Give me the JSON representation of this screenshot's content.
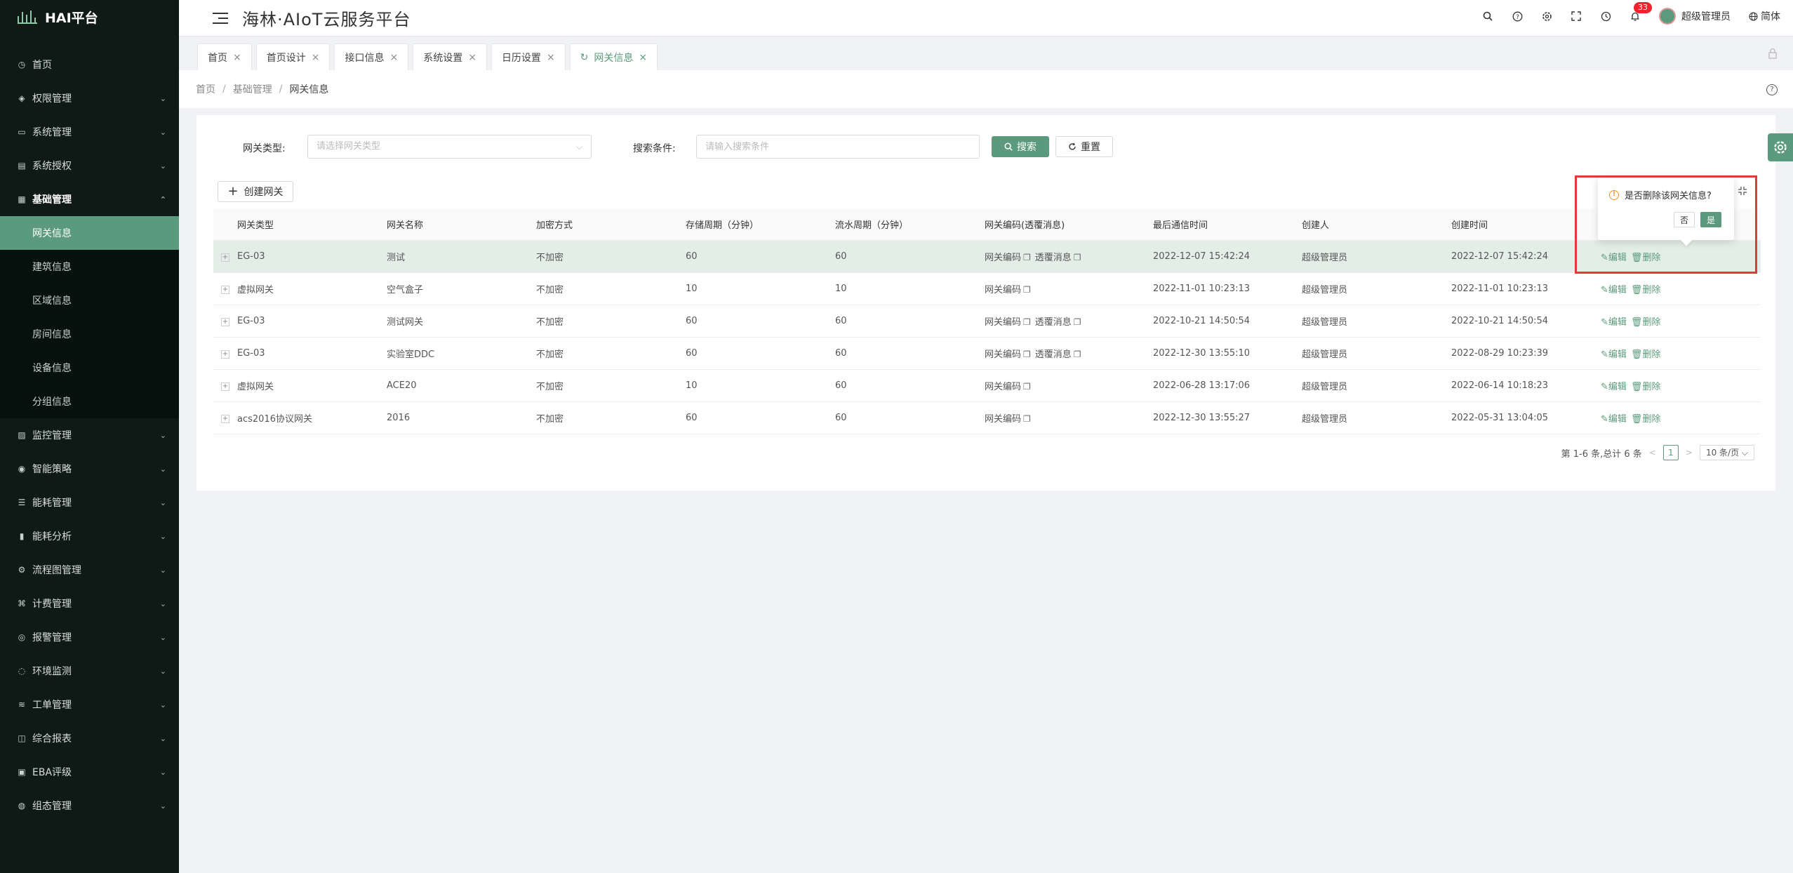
{
  "brand": {
    "name": "HAI平台"
  },
  "header": {
    "title": "海林·AIoT云服务平台",
    "notification_count": "33",
    "user_name": "超级管理员",
    "lang": "简体",
    "icons": [
      "search-icon",
      "question-icon",
      "settings-icon",
      "fullscreen-icon",
      "clock-icon",
      "bell-icon"
    ]
  },
  "sidebar": {
    "items": [
      {
        "label": "首页",
        "icon": "dashboard-icon"
      },
      {
        "label": "权限管理",
        "icon": "shield-icon"
      },
      {
        "label": "系统管理",
        "icon": "monitor-icon"
      },
      {
        "label": "系统授权",
        "icon": "license-icon"
      },
      {
        "label": "基础管理",
        "icon": "grid-icon"
      }
    ],
    "sub_items": [
      {
        "label": "网关信息"
      },
      {
        "label": "建筑信息"
      },
      {
        "label": "区域信息"
      },
      {
        "label": "房间信息"
      },
      {
        "label": "设备信息"
      },
      {
        "label": "分组信息"
      }
    ],
    "items_after": [
      {
        "label": "监控管理"
      },
      {
        "label": "智能策略"
      },
      {
        "label": "能耗管理"
      },
      {
        "label": "能耗分析"
      },
      {
        "label": "流程图管理"
      },
      {
        "label": "计费管理"
      },
      {
        "label": "报警管理"
      },
      {
        "label": "环境监测"
      },
      {
        "label": "工单管理"
      },
      {
        "label": "综合报表"
      },
      {
        "label": "EBA评级"
      },
      {
        "label": "组态管理"
      }
    ]
  },
  "tabs": [
    {
      "label": "首页"
    },
    {
      "label": "首页设计"
    },
    {
      "label": "接口信息"
    },
    {
      "label": "系统设置"
    },
    {
      "label": "日历设置"
    },
    {
      "label": "网关信息"
    }
  ],
  "breadcrumb": {
    "home": "首页",
    "parent": "基础管理",
    "current": "网关信息"
  },
  "search": {
    "type_label": "网关类型:",
    "type_placeholder": "请选择网关类型",
    "cond_label": "搜索条件:",
    "cond_placeholder": "请输入搜索条件",
    "search_btn": "搜索",
    "reset_btn": "重置"
  },
  "create_btn": "创建网关",
  "table": {
    "columns": [
      "网关类型",
      "网关名称",
      "加密方式",
      "存储周期（分钟）",
      "流水周期（分钟）",
      "网关编码(透覆消息)",
      "最后通信时间",
      "创建人",
      "创建时间"
    ],
    "code_label": "网关编码",
    "msg_label": "透覆消息",
    "edit_label": "编辑",
    "delete_label": "删除",
    "rows": [
      {
        "type": "EG-03",
        "name": "测试",
        "enc": "不加密",
        "store": "60",
        "flow": "60",
        "has_msg": true,
        "last": "2022-12-07 15:42:24",
        "creator": "超级管理员",
        "created": "2022-12-07 15:42:24"
      },
      {
        "type": "虚拟网关",
        "name": "空气盒子",
        "enc": "不加密",
        "store": "10",
        "flow": "10",
        "has_msg": false,
        "last": "2022-11-01 10:23:13",
        "creator": "超级管理员",
        "created": "2022-11-01 10:23:13"
      },
      {
        "type": "EG-03",
        "name": "测试网关",
        "enc": "不加密",
        "store": "60",
        "flow": "60",
        "has_msg": true,
        "last": "2022-10-21 14:50:54",
        "creator": "超级管理员",
        "created": "2022-10-21 14:50:54"
      },
      {
        "type": "EG-03",
        "name": "实验室DDC",
        "enc": "不加密",
        "store": "60",
        "flow": "60",
        "has_msg": true,
        "last": "2022-12-30 13:55:10",
        "creator": "超级管理员",
        "created": "2022-08-29 10:23:39"
      },
      {
        "type": "虚拟网关",
        "name": "ACE20",
        "enc": "不加密",
        "store": "10",
        "flow": "60",
        "has_msg": false,
        "last": "2022-06-28 13:17:06",
        "creator": "超级管理员",
        "created": "2022-06-14 10:18:23"
      },
      {
        "type": "acs2016协议网关",
        "name": "2016",
        "enc": "不加密",
        "store": "60",
        "flow": "60",
        "has_msg": false,
        "last": "2022-12-30 13:55:27",
        "creator": "超级管理员",
        "created": "2022-05-31 13:04:05"
      }
    ]
  },
  "popconfirm": {
    "message": "是否删除该网关信息?",
    "no": "否",
    "yes": "是"
  },
  "pagination": {
    "summary": "第 1-6 条,总计 6 条",
    "current": "1",
    "page_size": "10 条/页"
  },
  "colors": {
    "primary": "#5b9a7c",
    "sidebar_bg": "#0f1a17",
    "highlight": "#e53935"
  }
}
